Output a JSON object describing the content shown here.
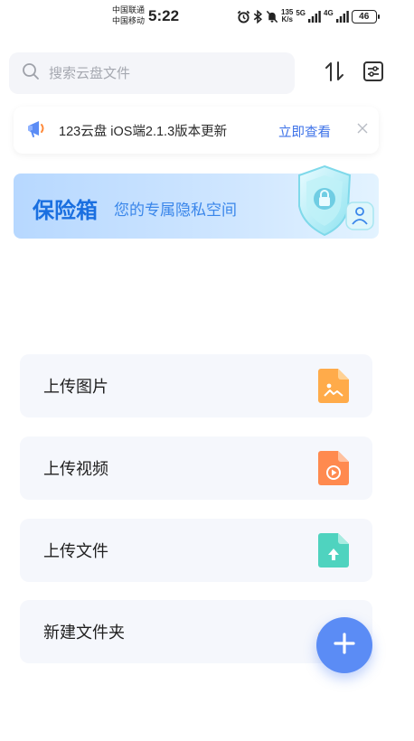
{
  "status_bar": {
    "carrier_1": "中国联通",
    "carrier_2": "中国移动",
    "time": "5:22",
    "speed_value": "135",
    "speed_unit": "K/s",
    "network_1": "5G",
    "network_2": "4G",
    "battery": "46"
  },
  "search": {
    "placeholder": "搜索云盘文件",
    "icon": "search-icon"
  },
  "toolbar": {
    "sort_icon": "sort-icon",
    "filter_icon": "filter-settings-icon"
  },
  "notice": {
    "text": "123云盘 iOS端2.1.3版本更新",
    "link": "立即查看",
    "icon": "megaphone-icon",
    "close_icon": "close-icon"
  },
  "safe_box": {
    "title": "保险箱",
    "subtitle": "您的专属隐私空间",
    "icon": "shield-lock-icon"
  },
  "actions": [
    {
      "label": "上传图片",
      "icon": "image-file-icon",
      "color": "#ffab4a"
    },
    {
      "label": "上传视频",
      "icon": "video-file-icon",
      "color": "#ff8a4f"
    },
    {
      "label": "上传文件",
      "icon": "upload-file-icon",
      "color": "#4fd3bf"
    },
    {
      "label": "新建文件夹",
      "icon": "folder-icon",
      "color": "#ffd27a"
    }
  ],
  "fab": {
    "icon": "plus-icon",
    "color": "#5b8cf5"
  }
}
